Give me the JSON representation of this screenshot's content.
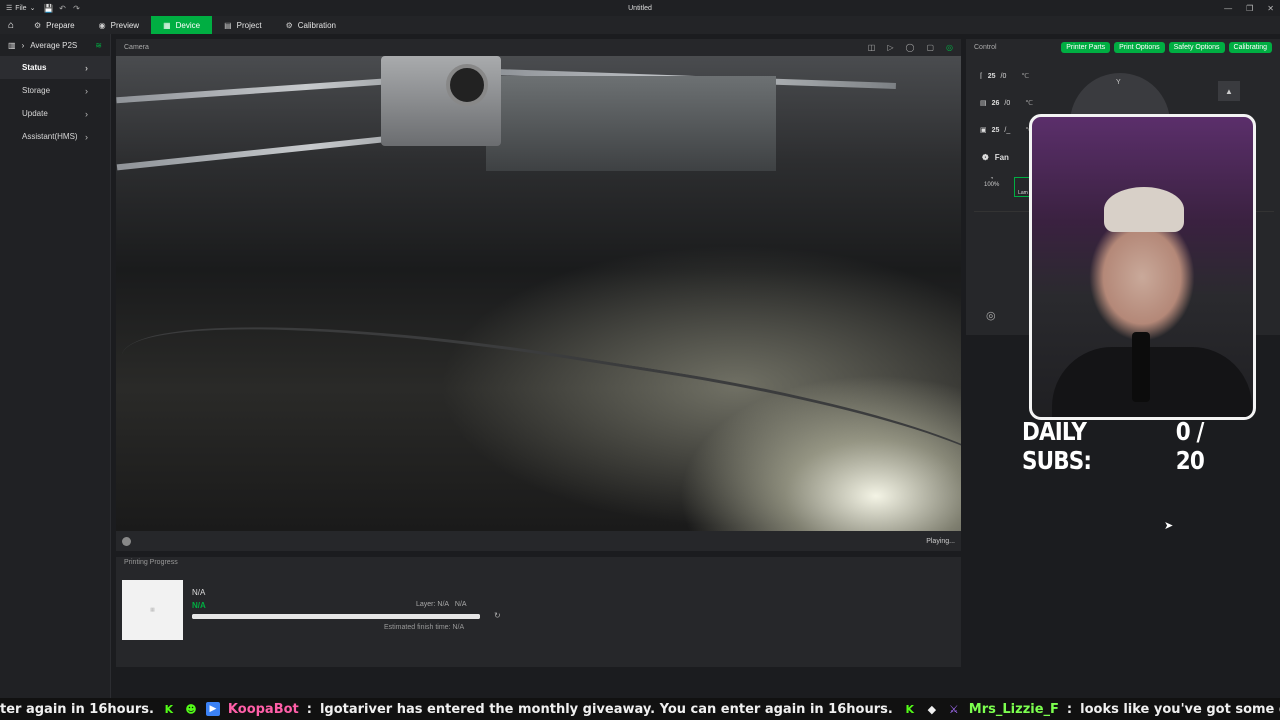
{
  "topbar": {
    "file_label": "File",
    "title": "Untitled"
  },
  "nav": {
    "tabs": [
      {
        "label": "Prepare"
      },
      {
        "label": "Preview"
      },
      {
        "label": "Device"
      },
      {
        "label": "Project"
      },
      {
        "label": "Calibration"
      }
    ],
    "active": "Device"
  },
  "sidebar": {
    "printer_name": "Average P2S",
    "items": [
      {
        "label": "Status"
      },
      {
        "label": "Storage"
      },
      {
        "label": "Update"
      },
      {
        "label": "Assistant(HMS)"
      }
    ]
  },
  "camera": {
    "title": "Camera",
    "status": "Playing..."
  },
  "progress": {
    "title": "Printing Progress",
    "name": "N/A",
    "percent": "N/A",
    "layer": "Layer: N/A",
    "layer_total": "N/A",
    "eta": "Estimated finish time: N/A",
    "fill_fraction": 1.0
  },
  "control": {
    "title": "Control",
    "pills": [
      "Printer Parts",
      "Print Options",
      "Safety Options",
      "Calibrating"
    ],
    "temps": [
      {
        "value": "25",
        "target": "/0",
        "unit": "℃"
      },
      {
        "value": "26",
        "target": "/0",
        "unit": "℃"
      },
      {
        "value": "25",
        "target": "/_",
        "unit": "℃"
      }
    ],
    "fan_label": "Fan",
    "speed_label": "100%",
    "lamp_label": "Lam",
    "jog_y_label": "Y"
  },
  "overlay": {
    "subs_label": "DAILY SUBS:",
    "subs_count": "0 / 20"
  },
  "ticker": {
    "lead_text": "ter again in 16hours.",
    "user1": "KoopaBot",
    "msg1": "lgotariver has entered the monthly giveaway. You can enter again in 16hours.",
    "user2": "Mrs_Lizzie_F",
    "msg2": "looks like you've got some dust in there"
  },
  "colors": {
    "accent": "#00ae42",
    "background": "#1b1c1f",
    "panel": "#26272a"
  }
}
